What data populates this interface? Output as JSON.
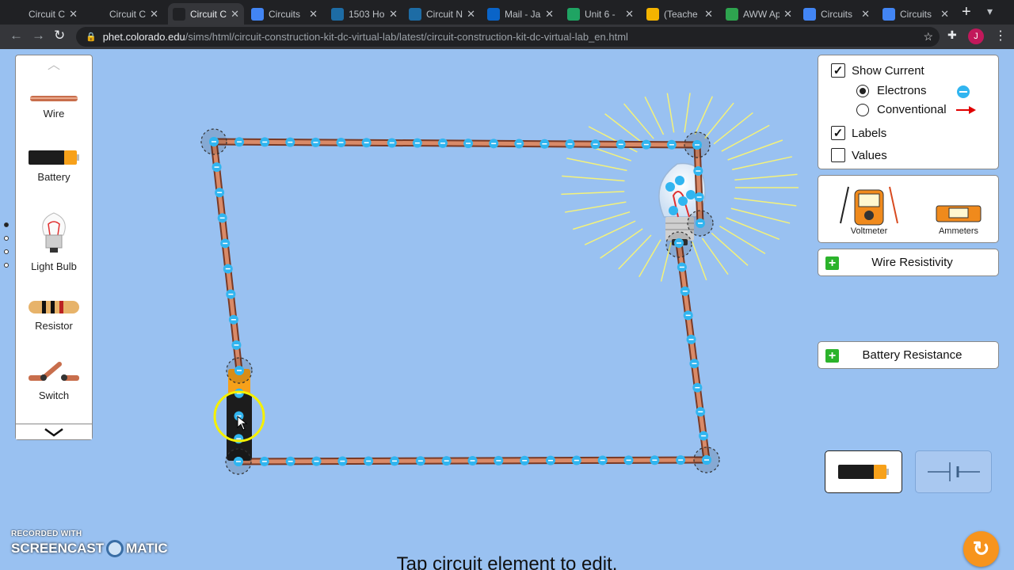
{
  "browser": {
    "tabs": [
      {
        "label": "Circuit C",
        "icon": "phet-icon",
        "color": "#202124"
      },
      {
        "label": "Circuit C",
        "icon": "phet-icon",
        "color": "#202124"
      },
      {
        "label": "Circuit C",
        "icon": "phet-icon",
        "color": "#202124",
        "active": true
      },
      {
        "label": "Circuits",
        "icon": "docs-icon",
        "color": "#4285f4"
      },
      {
        "label": "1503 Ho",
        "icon": "schoology-icon",
        "color": "#1d6ca5"
      },
      {
        "label": "Circuit N",
        "icon": "schoology-icon",
        "color": "#1d6ca5"
      },
      {
        "label": "Mail - Ja",
        "icon": "outlook-icon",
        "color": "#0a64c8"
      },
      {
        "label": "Unit 6 -",
        "icon": "drive-icon",
        "color": "#1fa463"
      },
      {
        "label": "(Teache",
        "icon": "slides-icon",
        "color": "#f4b400"
      },
      {
        "label": "AWW Ap",
        "icon": "aww-icon",
        "color": "#2ea44f"
      },
      {
        "label": "Circuits",
        "icon": "docs-icon",
        "color": "#4285f4"
      },
      {
        "label": "Circuits",
        "icon": "docs-icon",
        "color": "#4285f4"
      }
    ],
    "url_host": "phet.colorado.edu",
    "url_path": "/sims/html/circuit-construction-kit-dc-virtual-lab/latest/circuit-construction-kit-dc-virtual-lab_en.html",
    "profile_initial": "J"
  },
  "toolbox": {
    "items": [
      {
        "label": "Wire"
      },
      {
        "label": "Battery"
      },
      {
        "label": "Light Bulb"
      },
      {
        "label": "Resistor"
      },
      {
        "label": "Switch"
      }
    ]
  },
  "controls": {
    "show_current": {
      "label": "Show Current",
      "checked": true
    },
    "electrons": {
      "label": "Electrons",
      "selected": true
    },
    "conventional": {
      "label": "Conventional",
      "selected": false
    },
    "labels": {
      "label": "Labels",
      "checked": true
    },
    "values": {
      "label": "Values",
      "checked": false
    },
    "voltmeter": {
      "label": "Voltmeter"
    },
    "ammeters": {
      "label": "Ammeters"
    },
    "wire_resistivity": "Wire Resistivity",
    "battery_resistance": "Battery Resistance"
  },
  "hint": "Tap circuit element to edit.",
  "watermark": {
    "top": "RECORDED WITH",
    "brand_left": "SCREENCAST",
    "brand_right": "MATIC"
  },
  "colors": {
    "background": "#99c1f1",
    "wire": "#c86e4c",
    "electron": "#31b5f0",
    "plus": "#2bb32b",
    "reset": "#f7941d",
    "conventional_arrow": "#e00000"
  }
}
